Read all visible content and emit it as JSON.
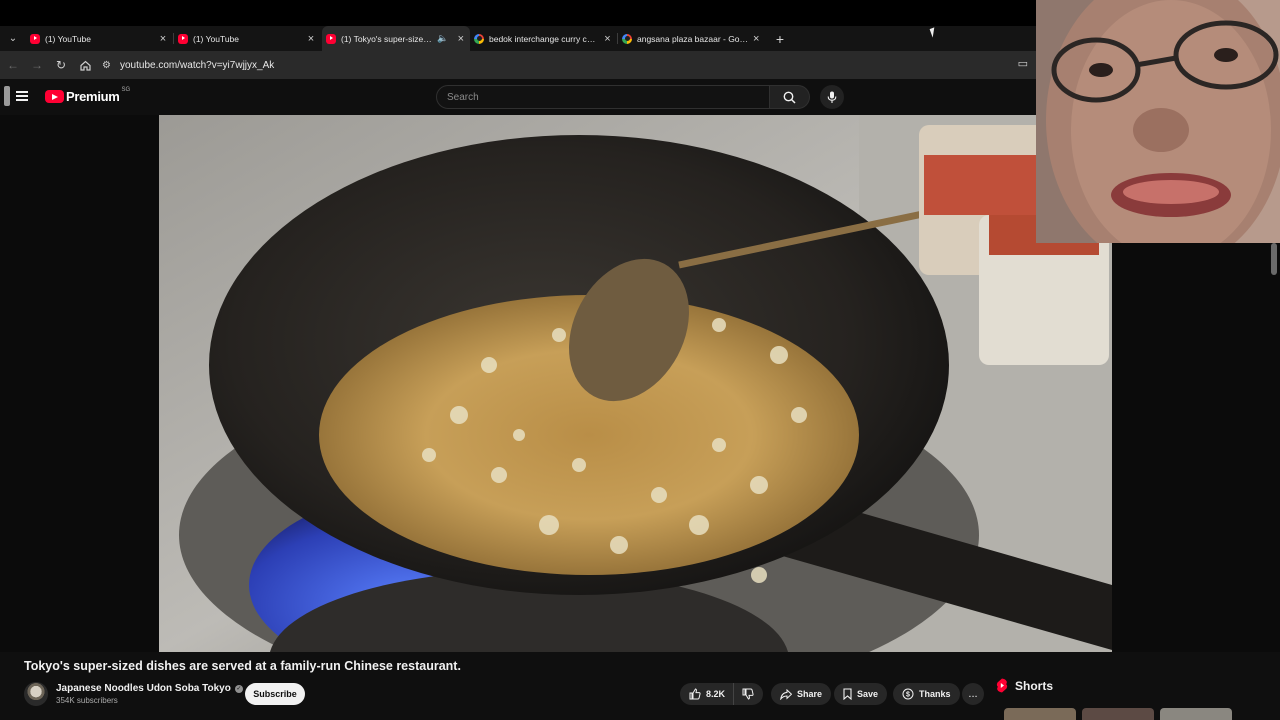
{
  "browser": {
    "tabs": [
      {
        "title": "(1) YouTube",
        "favicon": "youtube-icon",
        "active": false
      },
      {
        "title": "(1) YouTube",
        "favicon": "youtube-icon",
        "active": false
      },
      {
        "title": "(1) Tokyo's super-sized dishes are served at a family-run Chinese restaurant.",
        "favicon": "youtube-icon",
        "active": true,
        "audio": true
      },
      {
        "title": "bedok interchange curry chicken",
        "favicon": "google-icon",
        "active": false
      },
      {
        "title": "angsana plaza bazaar - Google Search",
        "favicon": "google-icon",
        "active": false
      }
    ],
    "url": "youtube.com/watch?v=yi7wjjyx_Ak"
  },
  "masthead": {
    "logo_text": "Premium",
    "region": "SG",
    "search_placeholder": "Search"
  },
  "video": {
    "title": "Tokyo's super-sized dishes are served at a family-run Chinese restaurant.",
    "channel": {
      "name": "Japanese Noodles Udon Soba Tokyo",
      "subscribers": "354K subscribers",
      "subscribe_label": "Subscribe"
    },
    "actions": {
      "likes": "8.2K",
      "share": "Share",
      "save": "Save",
      "thanks": "Thanks",
      "more": "..."
    }
  },
  "sidebar": {
    "shorts_label": "Shorts"
  },
  "colors": {
    "youtube_red": "#ff0033",
    "background": "#0f0f0f",
    "pill": "#272727"
  }
}
